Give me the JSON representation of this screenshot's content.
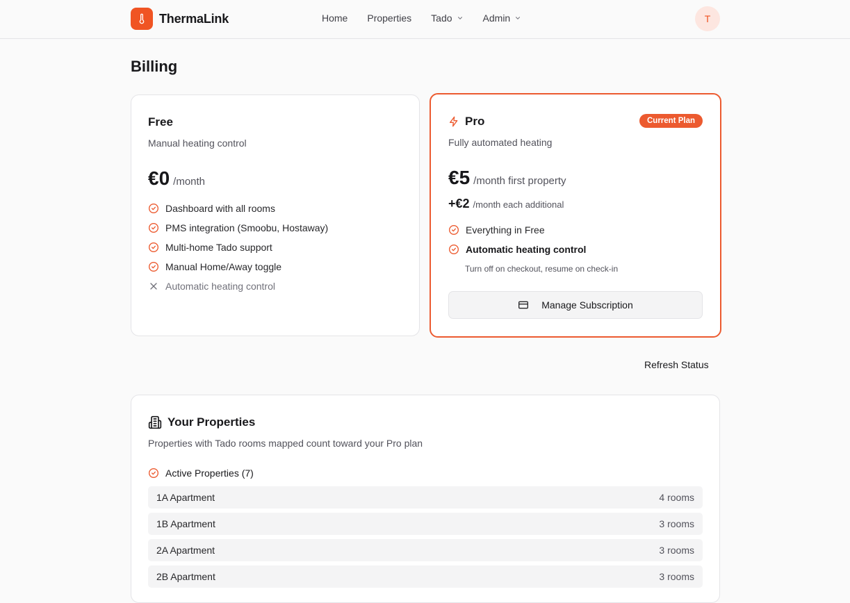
{
  "app": {
    "name": "ThermaLink",
    "avatar_initial": "T",
    "brand_color": "#f05423"
  },
  "nav": {
    "home": "Home",
    "properties": "Properties",
    "tado": "Tado",
    "admin": "Admin"
  },
  "page": {
    "title": "Billing"
  },
  "free_plan": {
    "name": "Free",
    "description": "Manual heating control",
    "price": "€0",
    "price_unit": "/month",
    "features": [
      {
        "label": "Dashboard with all rooms",
        "included": true
      },
      {
        "label": "PMS integration (Smoobu, Hostaway)",
        "included": true
      },
      {
        "label": "Multi-home Tado support",
        "included": true
      },
      {
        "label": "Manual Home/Away toggle",
        "included": true
      },
      {
        "label": "Automatic heating control",
        "included": false
      }
    ]
  },
  "pro_plan": {
    "name": "Pro",
    "badge": "Current Plan",
    "description": "Fully automated heating",
    "price": "€5",
    "price_unit": "/month first property",
    "extra_price": "+€2",
    "extra_unit": "/month each additional",
    "features": [
      {
        "label": "Everything in Free",
        "included": true
      },
      {
        "label": "Automatic heating control",
        "included": true,
        "note": "Turn off on checkout, resume on check-in"
      }
    ],
    "manage_button": "Manage Subscription"
  },
  "refresh_label": "Refresh Status",
  "properties_section": {
    "title": "Your Properties",
    "description": "Properties with Tado rooms mapped count toward your Pro plan",
    "active_label": "Active Properties (7)",
    "items": [
      {
        "name": "1A Apartment",
        "rooms": "4 rooms"
      },
      {
        "name": "1B Apartment",
        "rooms": "3 rooms"
      },
      {
        "name": "2A Apartment",
        "rooms": "3 rooms"
      },
      {
        "name": "2B Apartment",
        "rooms": "3 rooms"
      }
    ]
  }
}
